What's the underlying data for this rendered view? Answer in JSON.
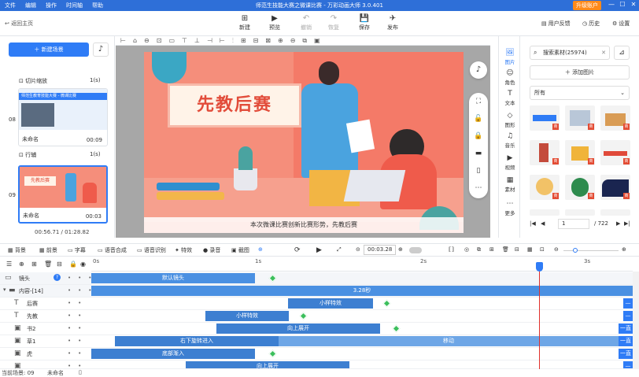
{
  "titlebar": {
    "menu": [
      "文件",
      "编辑",
      "操作",
      "时间轴",
      "帮助"
    ],
    "title": "师范生技能大赛之微课比赛 - 万彩动画大师 3.0.401",
    "upgrade": "升级账户"
  },
  "toolbar": {
    "back": "返回主页",
    "buttons": [
      {
        "label": "新建",
        "icon": "⊞",
        "enabled": true
      },
      {
        "label": "预览",
        "icon": "▶",
        "enabled": true
      },
      {
        "label": "撤销",
        "icon": "↶",
        "enabled": false
      },
      {
        "label": "恢复",
        "icon": "↷",
        "enabled": false
      },
      {
        "label": "保存",
        "icon": "💾",
        "enabled": true
      },
      {
        "label": "发布",
        "icon": "✈",
        "enabled": true
      }
    ],
    "feedback": "用户反馈",
    "history": "历史",
    "settings": "设置"
  },
  "left": {
    "new_scene": "新建场景",
    "transitions": [
      {
        "name": "切片缩放",
        "dur": "1(s)"
      },
      {
        "name": "行辅",
        "dur": "1(s)"
      }
    ],
    "scenes": [
      {
        "no": "08",
        "name": "未命名",
        "time": "00:09",
        "headline": "师范生教育技能大赛 - 微课比赛"
      },
      {
        "no": "09",
        "name": "未命名",
        "time": "00:03",
        "headline": "先教后赛"
      }
    ],
    "time_current": "00:56.71",
    "time_total": "/ 01:28.82"
  },
  "canvas": {
    "headline": "先教后赛",
    "subtitle": "本次微课比赛创新比赛形势，先教后赛"
  },
  "sidenav": [
    {
      "label": "图片",
      "icon": "🖼",
      "active": true
    },
    {
      "label": "角色",
      "icon": "☺",
      "active": false
    },
    {
      "label": "文本",
      "icon": "T",
      "active": false
    },
    {
      "label": "图形",
      "icon": "◇",
      "active": false
    },
    {
      "label": "音乐",
      "icon": "♫",
      "active": false
    },
    {
      "label": "视频",
      "icon": "▶",
      "active": false
    },
    {
      "label": "素材",
      "icon": "▦",
      "active": false
    },
    {
      "label": "更多",
      "icon": "⋯",
      "active": false
    }
  ],
  "assets": {
    "search_value": "搜索素材(25974)",
    "add_image": "添加图片",
    "filter": "所有",
    "page": "1",
    "total_pages": "/ 722"
  },
  "timeline_toolbar": [
    "背景",
    "前景",
    "字幕",
    "语音合成",
    "语音识别",
    "特效",
    "录音",
    "截图"
  ],
  "timecode": "00:03.28",
  "ruler": [
    "0s",
    "1s",
    "2s",
    "3s"
  ],
  "tracks": [
    {
      "label": "镜头",
      "kind": "camera",
      "bars": [
        {
          "text": "默认镜头"
        }
      ]
    },
    {
      "label": "内容-[14]",
      "kind": "group",
      "bars": [
        {
          "text": "3.28秒"
        }
      ]
    },
    {
      "label": "后赛",
      "kind": "text",
      "bars": [
        {
          "text": "小样特效"
        }
      ],
      "end": "—"
    },
    {
      "label": "先教",
      "kind": "text",
      "bars": [
        {
          "text": "小样特效"
        }
      ],
      "end": "—"
    },
    {
      "label": "书2",
      "kind": "image",
      "bars": [
        {
          "text": "向上展开"
        }
      ],
      "end": "一直"
    },
    {
      "label": "草1",
      "kind": "image",
      "bars": [
        {
          "text": "右下旋转进入"
        },
        {
          "text": "移动"
        }
      ],
      "end": "一直"
    },
    {
      "label": "虎",
      "kind": "image",
      "bars": [
        {
          "text": "底部渐入"
        }
      ],
      "end": "一直"
    },
    {
      "label": "",
      "kind": "image",
      "bars": [
        {
          "text": "向上展开"
        }
      ],
      "end": "—"
    }
  ],
  "status": {
    "scene": "当前场景: 09",
    "name": "未命名"
  }
}
